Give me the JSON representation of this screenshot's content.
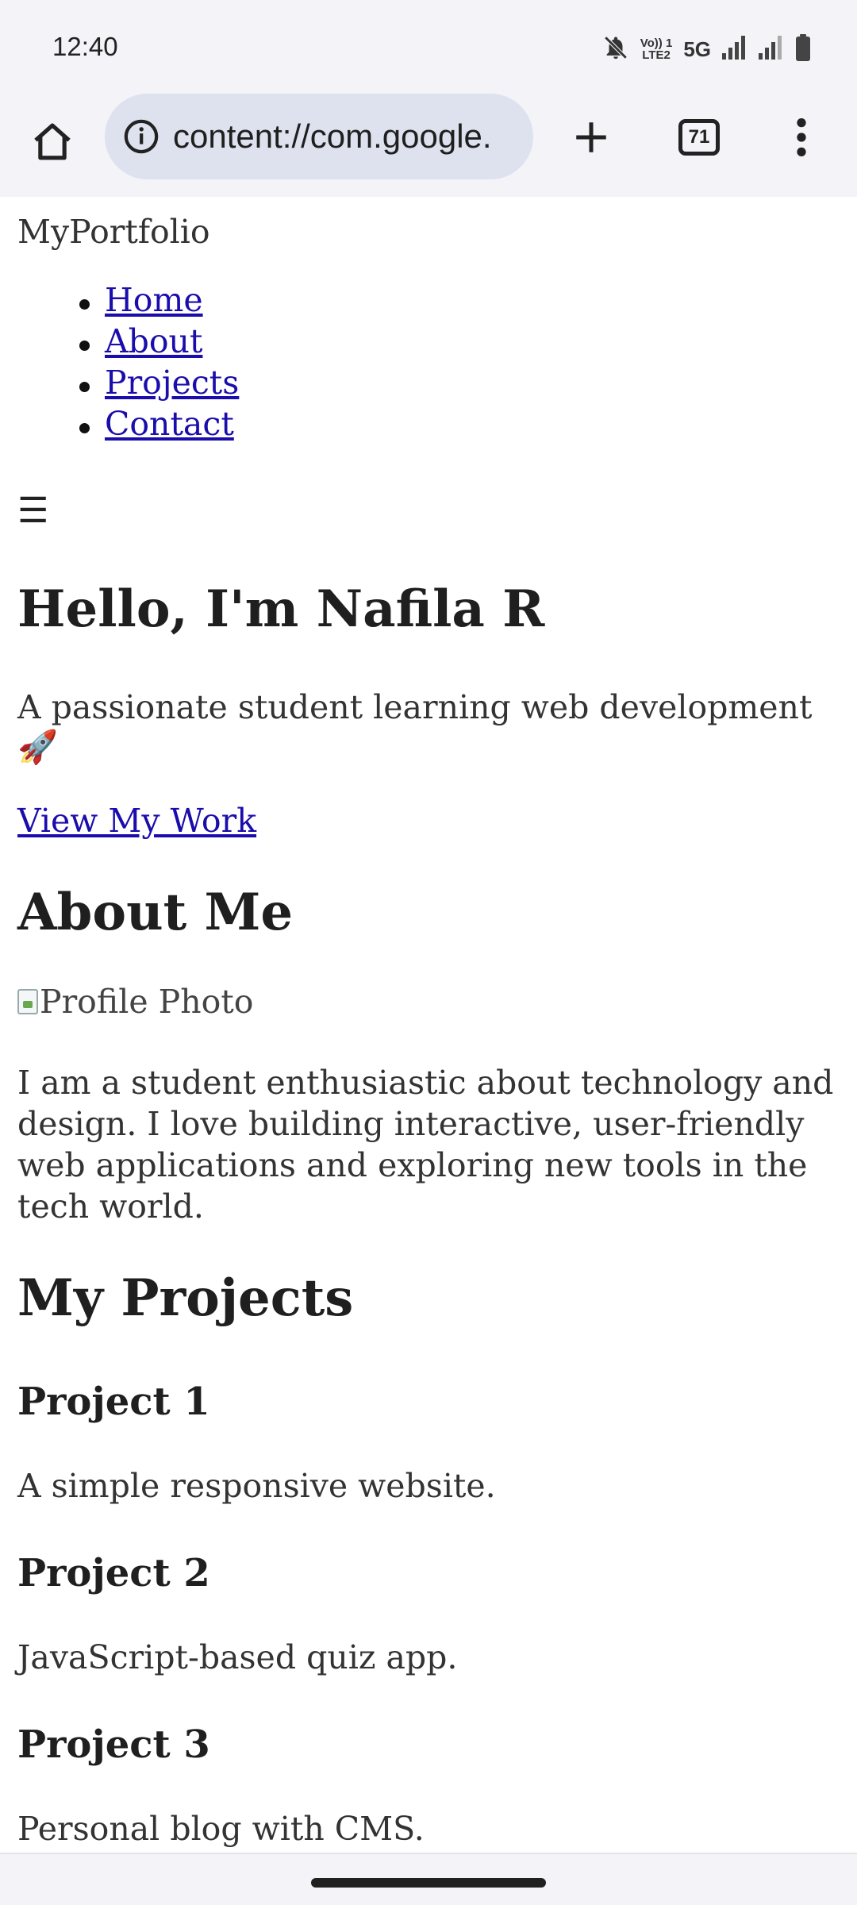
{
  "status_bar": {
    "time": "12:40",
    "network": "5G",
    "volte_line1": "Vo)) 1",
    "volte_line2": "LTE2",
    "icons": [
      "bell-off-icon",
      "volte-icon",
      "signal-icon",
      "signal-icon-2",
      "battery-icon"
    ]
  },
  "browser": {
    "url": "content://com.google.",
    "tab_count": "71",
    "icons": [
      "home-icon",
      "site-info-icon",
      "plus-icon",
      "tabs-icon",
      "more-vert-icon"
    ]
  },
  "page": {
    "logo": "MyPortfolio",
    "nav": [
      "Home",
      "About",
      "Projects",
      "Contact"
    ],
    "hamburger": "☰",
    "hero_title": "Hello, I'm Nafila R",
    "tagline": "A passionate student learning web development 🚀",
    "cta_link": "View My Work",
    "about_heading": "About Me",
    "profile_alt": "Profile Photo",
    "about_text": "I am a student enthusiastic about technology and design. I love building interactive, user-friendly web applications and exploring new tools in the tech world.",
    "projects_heading": "My Projects",
    "projects": [
      {
        "title": "Project 1",
        "desc": "A simple responsive website."
      },
      {
        "title": "Project 2",
        "desc": "JavaScript-based quiz app."
      },
      {
        "title": "Project 3",
        "desc": "Personal blog with CMS."
      }
    ]
  },
  "colors": {
    "link": "#1a0dab",
    "chrome_bg": "#f3f3f8",
    "url_pill": "#dde2ee"
  }
}
